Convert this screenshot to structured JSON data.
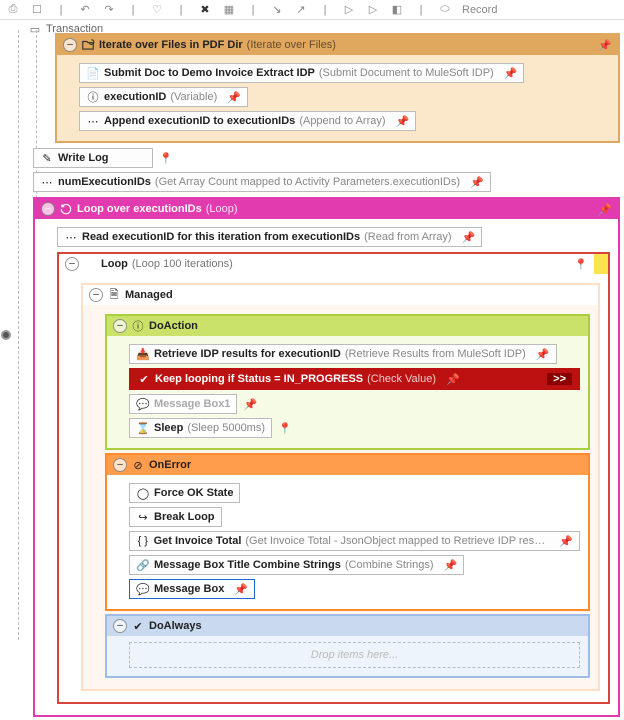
{
  "toolbar": {
    "record": "Record"
  },
  "tab": {
    "label": "Transaction"
  },
  "iterate": {
    "title": "Iterate over Files in PDF Dir",
    "sub": "(Iterate over Files)",
    "submit": {
      "title": "Submit Doc to Demo Invoice Extract IDP",
      "sub": "(Submit Document to MuleSoft IDP)"
    },
    "execId": {
      "title": "executionID",
      "sub": "(Variable)"
    },
    "append": {
      "title": "Append executionID to executionIDs",
      "sub": "(Append to Array)"
    }
  },
  "writeLog": {
    "title": "Write Log"
  },
  "numExec": {
    "title": "numExecutionIDs",
    "sub": "(Get Array Count mapped to Activity Parameters.executionIDs)"
  },
  "loopExec": {
    "title": "Loop over executionIDs",
    "sub": "(Loop)",
    "read": {
      "title": "Read executionID for this iteration from executionIDs",
      "sub": "(Read from Array)"
    },
    "loop100": {
      "title": "Loop",
      "sub": "(Loop 100 iterations)",
      "managed": {
        "title": "Managed"
      },
      "doAction": {
        "title": "DoAction",
        "retrieve": {
          "title": "Retrieve IDP results for executionID",
          "sub": "(Retrieve Results from MuleSoft IDP)"
        },
        "keep": {
          "title": "Keep looping if Status = IN_PROGRESS",
          "sub": "(Check Value)",
          "chev": ">>"
        },
        "msg1": {
          "title": "Message Box1"
        },
        "sleep": {
          "title": "Sleep",
          "sub": "(Sleep 5000ms)"
        }
      },
      "onError": {
        "title": "OnError",
        "force": {
          "title": "Force OK State"
        },
        "break": {
          "title": "Break Loop"
        },
        "getTotal": {
          "title": "Get Invoice Total",
          "sub": "(Get Invoice Total - JsonObject mapped to Retrieve IDP result...)"
        },
        "combine": {
          "title": "Message Box Title Combine Strings",
          "sub": "(Combine Strings)"
        },
        "msg": {
          "title": "Message Box"
        }
      },
      "doAlways": {
        "title": "DoAlways",
        "drop": "Drop items here..."
      }
    }
  }
}
